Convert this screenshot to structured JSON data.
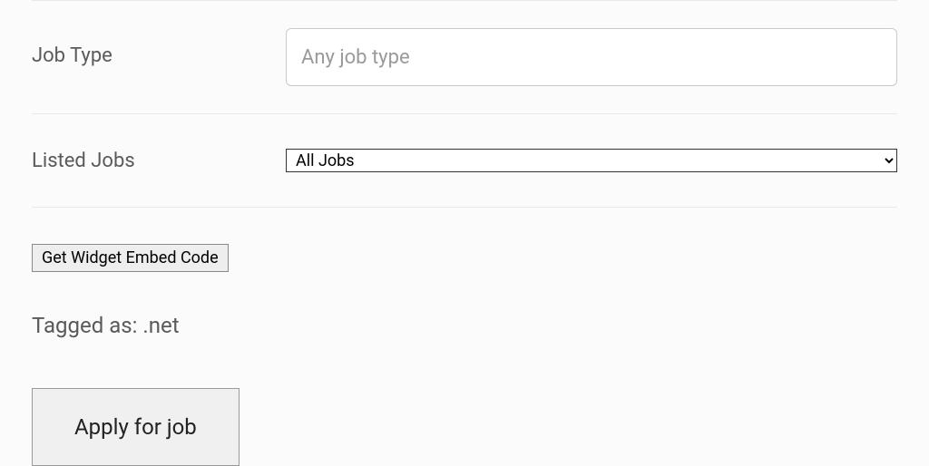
{
  "form": {
    "job_type": {
      "label": "Job Type",
      "placeholder": "Any job type",
      "value": ""
    },
    "listed_jobs": {
      "label": "Listed Jobs",
      "selected": "All Jobs"
    }
  },
  "widget_button": "Get Widget Embed Code",
  "tagged_as": "Tagged as: .net",
  "apply_button": "Apply for job"
}
